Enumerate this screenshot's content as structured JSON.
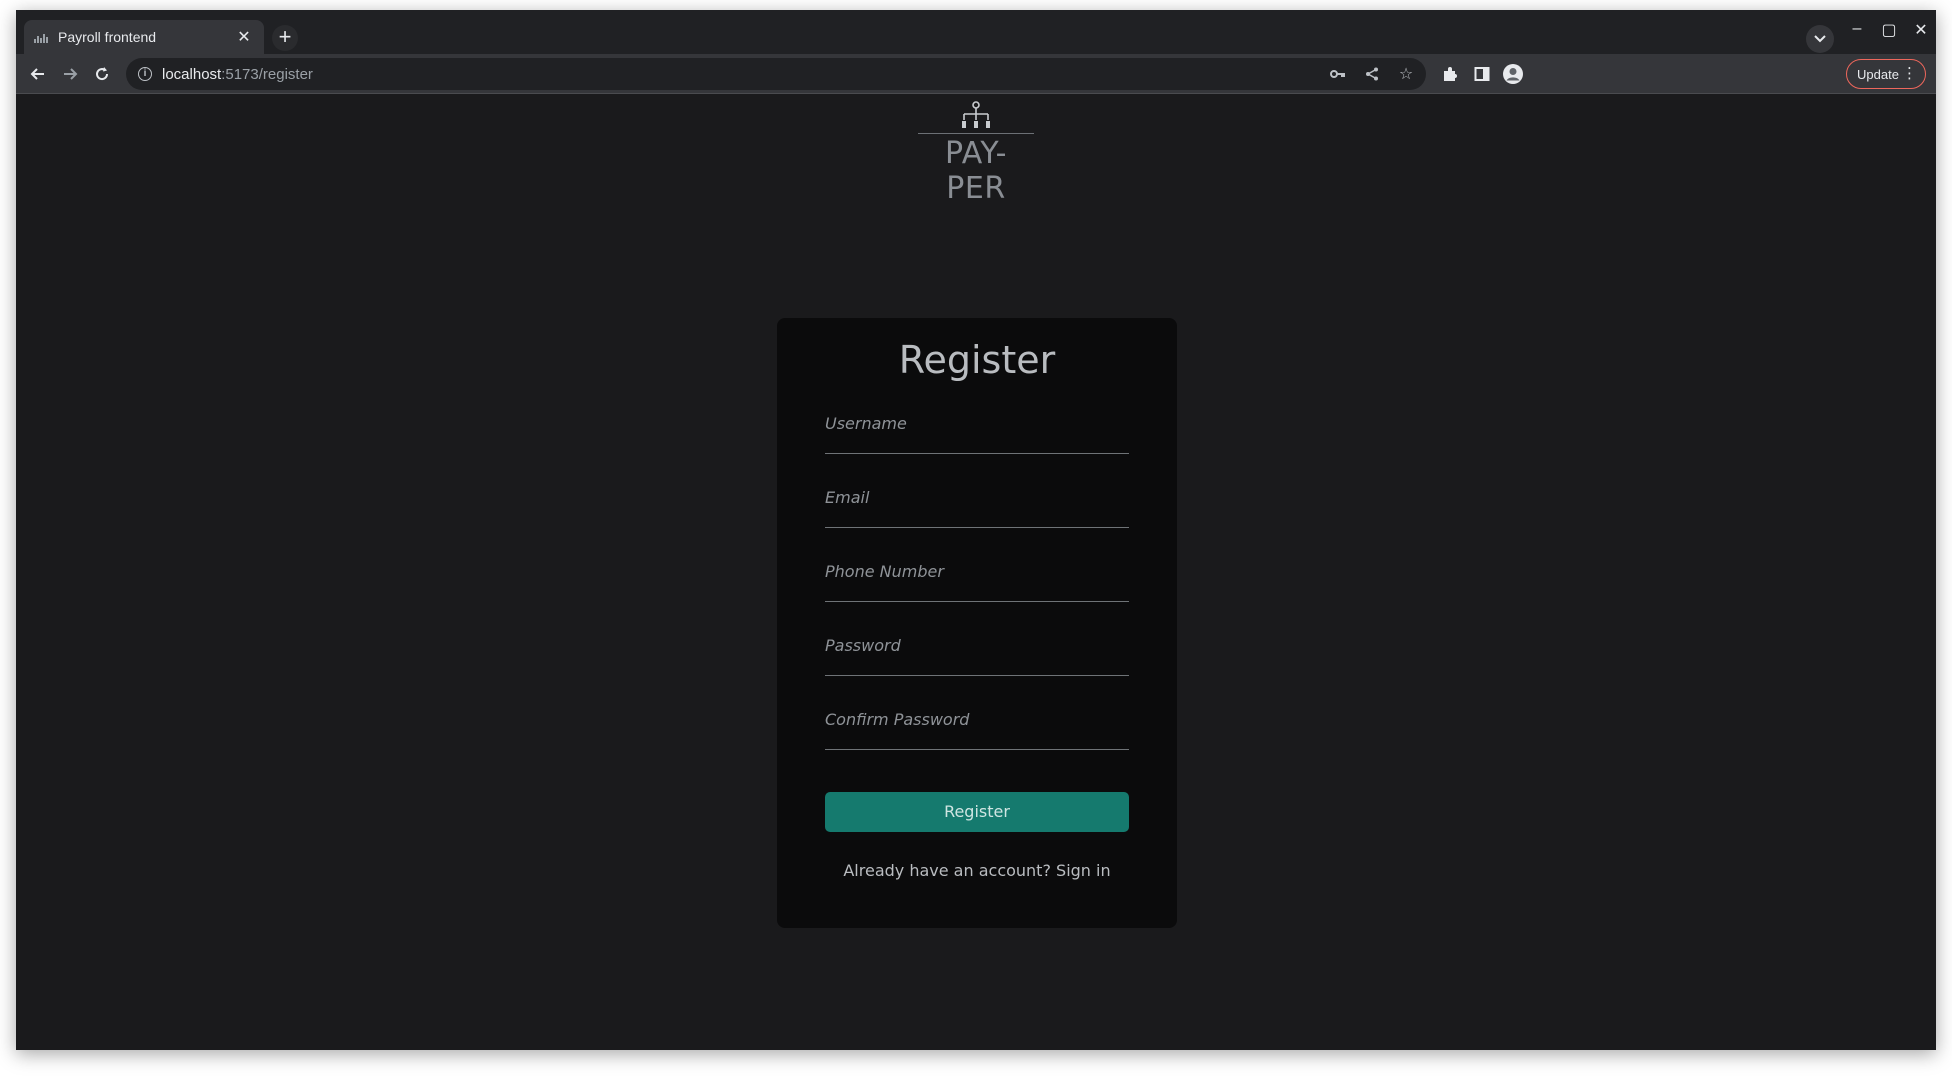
{
  "browser": {
    "tab_title": "Payroll frontend",
    "url_host": "localhost",
    "url_path": ":5173/register",
    "update_label": "Update",
    "icons": [
      "back-icon",
      "forward-icon",
      "reload-icon",
      "key-icon",
      "share-icon",
      "star-icon",
      "extensions-icon",
      "sidepanel-icon",
      "profile-icon"
    ]
  },
  "brand": {
    "name": "PAY-PER"
  },
  "form": {
    "title": "Register",
    "fields": {
      "username": "Username",
      "email": "Email",
      "phone": "Phone Number",
      "password": "Password",
      "confirm_password": "Confirm Password"
    },
    "submit_label": "Register",
    "signin_prompt": "Already have an account?",
    "signin_link": "Sign in"
  },
  "colors": {
    "background": "#1a1a1c",
    "card": "#0b0b0c",
    "accent": "#157a6e"
  }
}
